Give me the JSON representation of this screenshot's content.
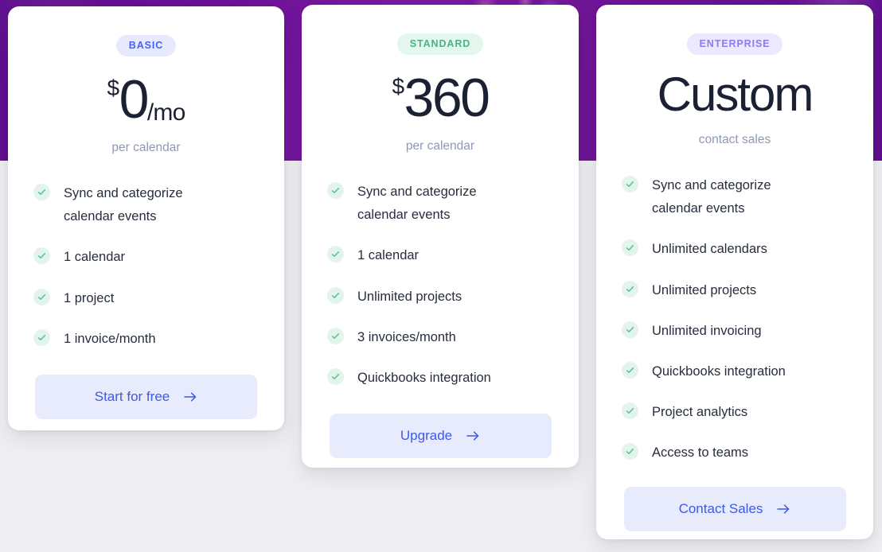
{
  "theme": {
    "band_purple": "#6b1196",
    "page_background": "#efeff1",
    "card_background": "#ffffff",
    "cta_background": "#e8ebfc",
    "cta_text": "#3e59e8",
    "check_green": "#56c39a",
    "check_bubble": "#e3f4ec",
    "price_text": "#1b2132",
    "muted_text": "#8d99b5"
  },
  "plans": [
    {
      "badge": "BASIC",
      "badge_style": "basic",
      "currency": "$",
      "amount": "0",
      "period": "/mo",
      "subtitle": "per calendar",
      "features": [
        "Sync and categorize calendar events",
        "1 calendar",
        "1 project",
        "1 invoice/month"
      ],
      "cta_label": "Start for free",
      "cta_icon": "arrow-right-icon"
    },
    {
      "badge": "STANDARD",
      "badge_style": "standard",
      "currency": "$",
      "amount": "360",
      "period": "",
      "subtitle": "per calendar",
      "features": [
        "Sync and categorize calendar events",
        "1 calendar",
        "Unlimited projects",
        "3 invoices/month",
        "Quickbooks integration"
      ],
      "cta_label": "Upgrade",
      "cta_icon": "arrow-right-icon"
    },
    {
      "badge": "ENTERPRISE",
      "badge_style": "enterprise",
      "currency": "",
      "amount": "Custom",
      "period": "",
      "subtitle": "contact sales",
      "features": [
        "Sync and categorize calendar events",
        "Unlimited calendars",
        "Unlimited projects",
        "Unlimited invoicing",
        "Quickbooks integration",
        "Project analytics",
        "Access to teams"
      ],
      "cta_label": "Contact Sales",
      "cta_icon": "arrow-right-icon"
    }
  ]
}
